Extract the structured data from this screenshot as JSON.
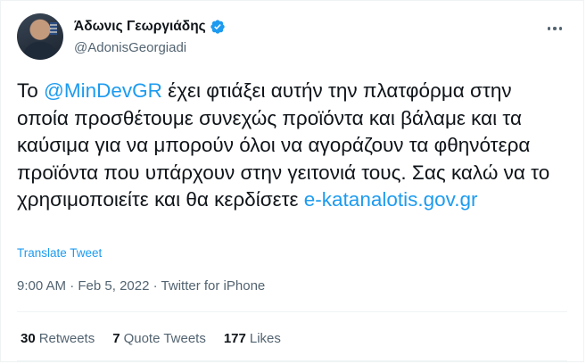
{
  "author": {
    "display_name": "Άδωνις Γεωργιάδης",
    "handle": "@AdonisGeorgiadi",
    "verified": true
  },
  "tweet": {
    "text_parts": {
      "p1": "Το ",
      "mention": "@MinDevGR",
      "p2": " έχει φτιάξει αυτήν την πλατφόρμα στην οποία προσθέτουμε συνεχώς προϊόντα και βάλαμε και τα καύσιμα για να μπορούν όλοι να αγοράζουν τα φθηνότερα προϊόντα που υπάρχουν στην γειτονιά τους. Σας καλώ να το χρησιμοποιείτε και θα κερδίσετε  ",
      "url": "e-katanalotis.gov.gr"
    },
    "translate_label": "Translate Tweet",
    "time": "9:00 AM",
    "date": "Feb 5, 2022",
    "separator": "·",
    "source": "Twitter for iPhone"
  },
  "stats": {
    "retweets_count": "30",
    "retweets_label": "Retweets",
    "quotes_count": "7",
    "quotes_label": "Quote Tweets",
    "likes_count": "177",
    "likes_label": "Likes"
  },
  "colors": {
    "link": "#1d9bf0",
    "muted": "#536471",
    "text": "#0f1419"
  },
  "icons": {
    "verified": "verified-badge-icon",
    "more": "more-options-icon"
  }
}
